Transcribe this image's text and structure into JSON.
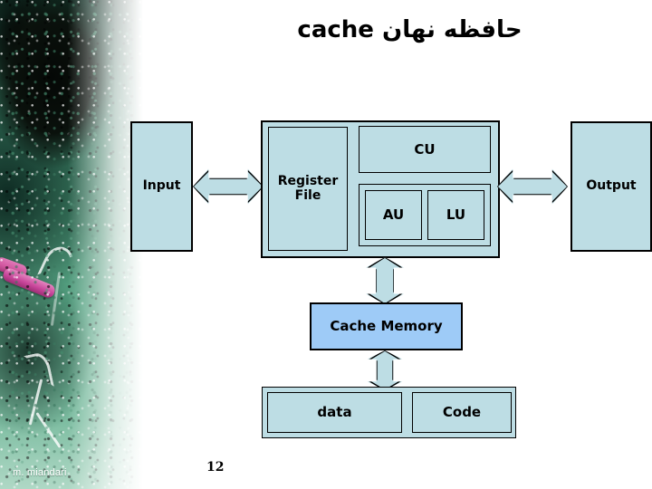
{
  "slide": {
    "title": "cache  حافظه نهان",
    "page_number": "12",
    "author": "m. miandari",
    "background_color": "#ffffff"
  },
  "colors": {
    "box_fill": "#bddde4",
    "cache_fill": "#9ecbf7",
    "border": "#000000",
    "arrow_fill": "#bddde4",
    "deco_green": "#3f8367",
    "chalk_pink": "#c8459a"
  },
  "diagram": {
    "io": {
      "input_label": "Input",
      "output_label": "Output"
    },
    "cpu": {
      "register_file_label": "Register File",
      "cu_label": "CU",
      "au_label": "AU",
      "lu_label": "LU"
    },
    "memory": {
      "cache_label": "Cache Memory",
      "data_label": "data",
      "code_label": "Code"
    },
    "arrows": [
      {
        "name": "input-cpu-arrow",
        "direction": "horizontal-bidirectional"
      },
      {
        "name": "cpu-output-arrow",
        "direction": "horizontal-bidirectional"
      },
      {
        "name": "cpu-cache-arrow",
        "direction": "vertical-bidirectional"
      },
      {
        "name": "cache-memory-arrow",
        "direction": "vertical-bidirectional"
      }
    ]
  }
}
